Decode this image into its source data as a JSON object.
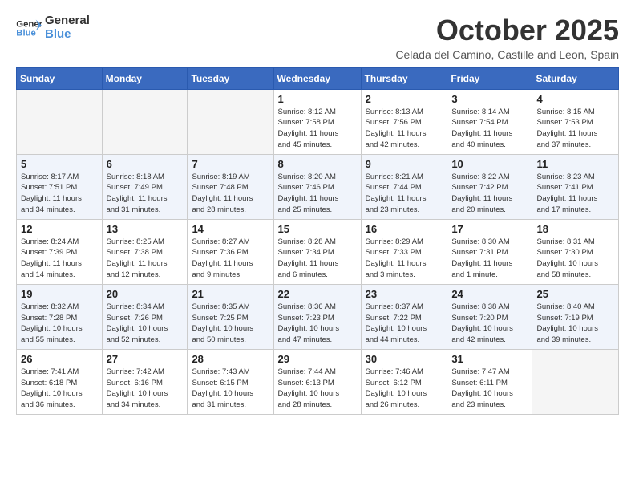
{
  "logo": {
    "line1": "General",
    "line2": "Blue"
  },
  "title": "October 2025",
  "subtitle": "Celada del Camino, Castille and Leon, Spain",
  "weekdays": [
    "Sunday",
    "Monday",
    "Tuesday",
    "Wednesday",
    "Thursday",
    "Friday",
    "Saturday"
  ],
  "weeks": [
    [
      {
        "day": "",
        "info": ""
      },
      {
        "day": "",
        "info": ""
      },
      {
        "day": "",
        "info": ""
      },
      {
        "day": "1",
        "info": "Sunrise: 8:12 AM\nSunset: 7:58 PM\nDaylight: 11 hours\nand 45 minutes."
      },
      {
        "day": "2",
        "info": "Sunrise: 8:13 AM\nSunset: 7:56 PM\nDaylight: 11 hours\nand 42 minutes."
      },
      {
        "day": "3",
        "info": "Sunrise: 8:14 AM\nSunset: 7:54 PM\nDaylight: 11 hours\nand 40 minutes."
      },
      {
        "day": "4",
        "info": "Sunrise: 8:15 AM\nSunset: 7:53 PM\nDaylight: 11 hours\nand 37 minutes."
      }
    ],
    [
      {
        "day": "5",
        "info": "Sunrise: 8:17 AM\nSunset: 7:51 PM\nDaylight: 11 hours\nand 34 minutes."
      },
      {
        "day": "6",
        "info": "Sunrise: 8:18 AM\nSunset: 7:49 PM\nDaylight: 11 hours\nand 31 minutes."
      },
      {
        "day": "7",
        "info": "Sunrise: 8:19 AM\nSunset: 7:48 PM\nDaylight: 11 hours\nand 28 minutes."
      },
      {
        "day": "8",
        "info": "Sunrise: 8:20 AM\nSunset: 7:46 PM\nDaylight: 11 hours\nand 25 minutes."
      },
      {
        "day": "9",
        "info": "Sunrise: 8:21 AM\nSunset: 7:44 PM\nDaylight: 11 hours\nand 23 minutes."
      },
      {
        "day": "10",
        "info": "Sunrise: 8:22 AM\nSunset: 7:42 PM\nDaylight: 11 hours\nand 20 minutes."
      },
      {
        "day": "11",
        "info": "Sunrise: 8:23 AM\nSunset: 7:41 PM\nDaylight: 11 hours\nand 17 minutes."
      }
    ],
    [
      {
        "day": "12",
        "info": "Sunrise: 8:24 AM\nSunset: 7:39 PM\nDaylight: 11 hours\nand 14 minutes."
      },
      {
        "day": "13",
        "info": "Sunrise: 8:25 AM\nSunset: 7:38 PM\nDaylight: 11 hours\nand 12 minutes."
      },
      {
        "day": "14",
        "info": "Sunrise: 8:27 AM\nSunset: 7:36 PM\nDaylight: 11 hours\nand 9 minutes."
      },
      {
        "day": "15",
        "info": "Sunrise: 8:28 AM\nSunset: 7:34 PM\nDaylight: 11 hours\nand 6 minutes."
      },
      {
        "day": "16",
        "info": "Sunrise: 8:29 AM\nSunset: 7:33 PM\nDaylight: 11 hours\nand 3 minutes."
      },
      {
        "day": "17",
        "info": "Sunrise: 8:30 AM\nSunset: 7:31 PM\nDaylight: 11 hours\nand 1 minute."
      },
      {
        "day": "18",
        "info": "Sunrise: 8:31 AM\nSunset: 7:30 PM\nDaylight: 10 hours\nand 58 minutes."
      }
    ],
    [
      {
        "day": "19",
        "info": "Sunrise: 8:32 AM\nSunset: 7:28 PM\nDaylight: 10 hours\nand 55 minutes."
      },
      {
        "day": "20",
        "info": "Sunrise: 8:34 AM\nSunset: 7:26 PM\nDaylight: 10 hours\nand 52 minutes."
      },
      {
        "day": "21",
        "info": "Sunrise: 8:35 AM\nSunset: 7:25 PM\nDaylight: 10 hours\nand 50 minutes."
      },
      {
        "day": "22",
        "info": "Sunrise: 8:36 AM\nSunset: 7:23 PM\nDaylight: 10 hours\nand 47 minutes."
      },
      {
        "day": "23",
        "info": "Sunrise: 8:37 AM\nSunset: 7:22 PM\nDaylight: 10 hours\nand 44 minutes."
      },
      {
        "day": "24",
        "info": "Sunrise: 8:38 AM\nSunset: 7:20 PM\nDaylight: 10 hours\nand 42 minutes."
      },
      {
        "day": "25",
        "info": "Sunrise: 8:40 AM\nSunset: 7:19 PM\nDaylight: 10 hours\nand 39 minutes."
      }
    ],
    [
      {
        "day": "26",
        "info": "Sunrise: 7:41 AM\nSunset: 6:18 PM\nDaylight: 10 hours\nand 36 minutes."
      },
      {
        "day": "27",
        "info": "Sunrise: 7:42 AM\nSunset: 6:16 PM\nDaylight: 10 hours\nand 34 minutes."
      },
      {
        "day": "28",
        "info": "Sunrise: 7:43 AM\nSunset: 6:15 PM\nDaylight: 10 hours\nand 31 minutes."
      },
      {
        "day": "29",
        "info": "Sunrise: 7:44 AM\nSunset: 6:13 PM\nDaylight: 10 hours\nand 28 minutes."
      },
      {
        "day": "30",
        "info": "Sunrise: 7:46 AM\nSunset: 6:12 PM\nDaylight: 10 hours\nand 26 minutes."
      },
      {
        "day": "31",
        "info": "Sunrise: 7:47 AM\nSunset: 6:11 PM\nDaylight: 10 hours\nand 23 minutes."
      },
      {
        "day": "",
        "info": ""
      }
    ]
  ]
}
